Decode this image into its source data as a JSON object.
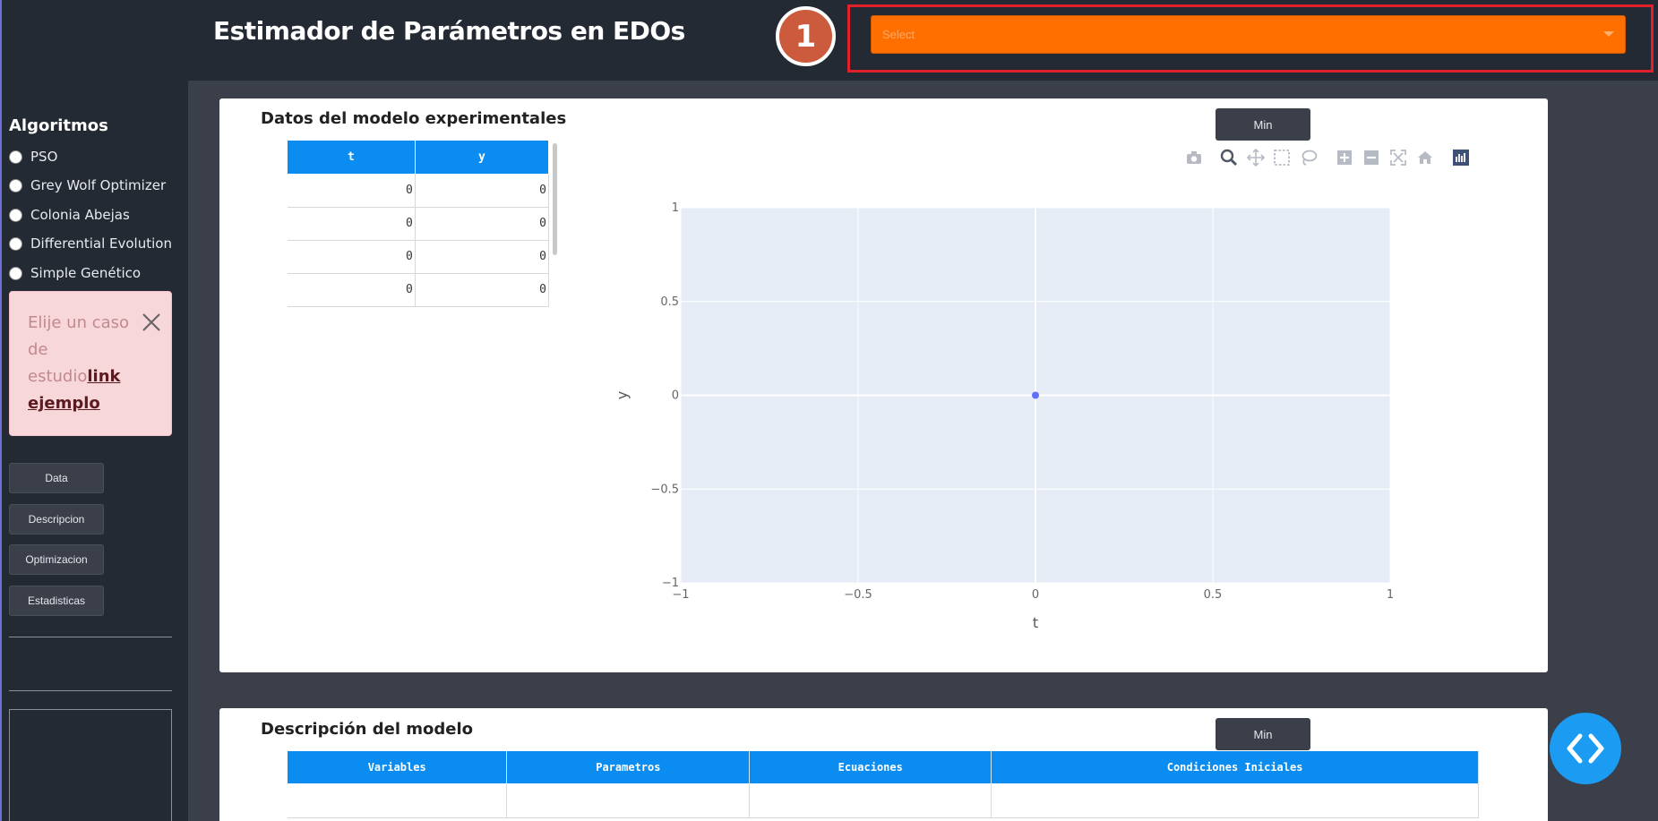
{
  "header": {
    "title": "Estimador de Parámetros en EDOs",
    "step_badge": "1",
    "select": {
      "placeholder": "Select",
      "color": "#ff6f00"
    }
  },
  "sidebar": {
    "title": "Algoritmos",
    "algorithms": [
      "PSO",
      "Grey Wolf Optimizer",
      "Colonia Abejas",
      "Differential Evolution",
      "Simple Genético"
    ],
    "alert": {
      "text": "Elije un caso de estudio",
      "link": "link ejemplo"
    },
    "buttons": [
      "Data",
      "Descripcion",
      "Optimizacion",
      "Estadisticas"
    ]
  },
  "data_card": {
    "title": "Datos del modelo experimentales",
    "min_label": "Min",
    "table": {
      "columns": [
        "t",
        "y"
      ],
      "rows": [
        [
          "0",
          "0"
        ],
        [
          "0",
          "0"
        ],
        [
          "0",
          "0"
        ],
        [
          "0",
          "0"
        ]
      ]
    },
    "toolbar_icons": [
      "camera-icon",
      "zoom-icon",
      "pan-icon",
      "box-select-icon",
      "lasso-icon",
      "zoom-in-icon",
      "zoom-out-icon",
      "autoscale-icon",
      "reset-axes-icon",
      "plotly-logo-icon"
    ]
  },
  "chart_data": {
    "type": "scatter",
    "x": [
      0
    ],
    "y": [
      0
    ],
    "xlabel": "t",
    "ylabel": "y",
    "xlim": [
      -1,
      1
    ],
    "ylim": [
      -1,
      1
    ],
    "xticks": [
      "−1",
      "−0.5",
      "0",
      "0.5",
      "1"
    ],
    "yticks": [
      "−1",
      "−0.5",
      "0",
      "0.5",
      "1"
    ],
    "grid": true,
    "marker_color": "#636efa",
    "plot_bg": "#e5ecf6"
  },
  "desc_card": {
    "title": "Descripción del modelo",
    "min_label": "Min",
    "columns": [
      "Variables",
      "Parametros",
      "Ecuaciones",
      "Condiciones Iniciales"
    ]
  },
  "fab": {
    "icon": "code-icon",
    "color": "#1b9cf2"
  }
}
